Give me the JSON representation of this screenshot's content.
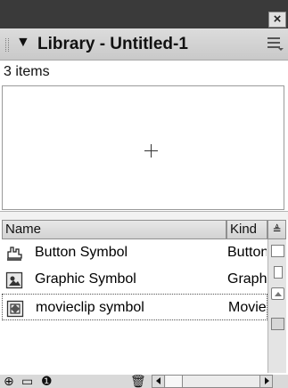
{
  "window": {
    "close_glyph": "×"
  },
  "panel": {
    "collapse_glyph": "▼",
    "title": "Library - Untitled-1",
    "options_icon": "panel-options-icon"
  },
  "items_count": "3 items",
  "preview": {
    "crosshair_icon": "crosshair-icon"
  },
  "columns": {
    "name": "Name",
    "kind": "Kind",
    "sort_glyph": "≜"
  },
  "rows": [
    {
      "name": "Button Symbol",
      "kind": "Button",
      "icon": "button-symbol-icon",
      "selected": false
    },
    {
      "name": "Graphic Symbol",
      "kind": "Graphic",
      "icon": "graphic-symbol-icon",
      "selected": false
    },
    {
      "name": "movieclip symbol",
      "kind": "Movie Clip",
      "icon": "movieclip-symbol-icon",
      "selected": true
    }
  ],
  "toolbar": {
    "new_symbol_glyph": "⊕",
    "new_folder_glyph": "▭",
    "properties_glyph": "❶",
    "delete_glyph": "🗑"
  },
  "colors": {
    "titlebar": "#3a3a3a",
    "panel_header": "#d0d0d0",
    "selection_border": "#555555"
  }
}
